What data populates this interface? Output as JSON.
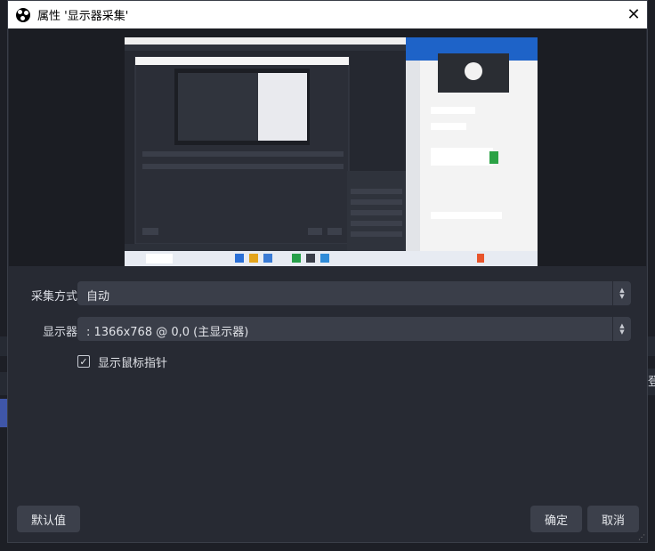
{
  "dialog": {
    "title": "属性 '显示器采集'",
    "close_icon": "close-icon",
    "app_icon": "obs-icon"
  },
  "form": {
    "capture_method": {
      "label": "采集方式",
      "value": "自动"
    },
    "display": {
      "label": "显示器",
      "value": ": 1366x768 @ 0,0 (主显示器)"
    },
    "show_cursor": {
      "label": "显示鼠标指针",
      "checked": true
    }
  },
  "buttons": {
    "defaults": "默认值",
    "ok": "确定",
    "cancel": "取消"
  },
  "background": {
    "edge_text": "登"
  },
  "preview": {
    "icon": "screen-preview"
  }
}
